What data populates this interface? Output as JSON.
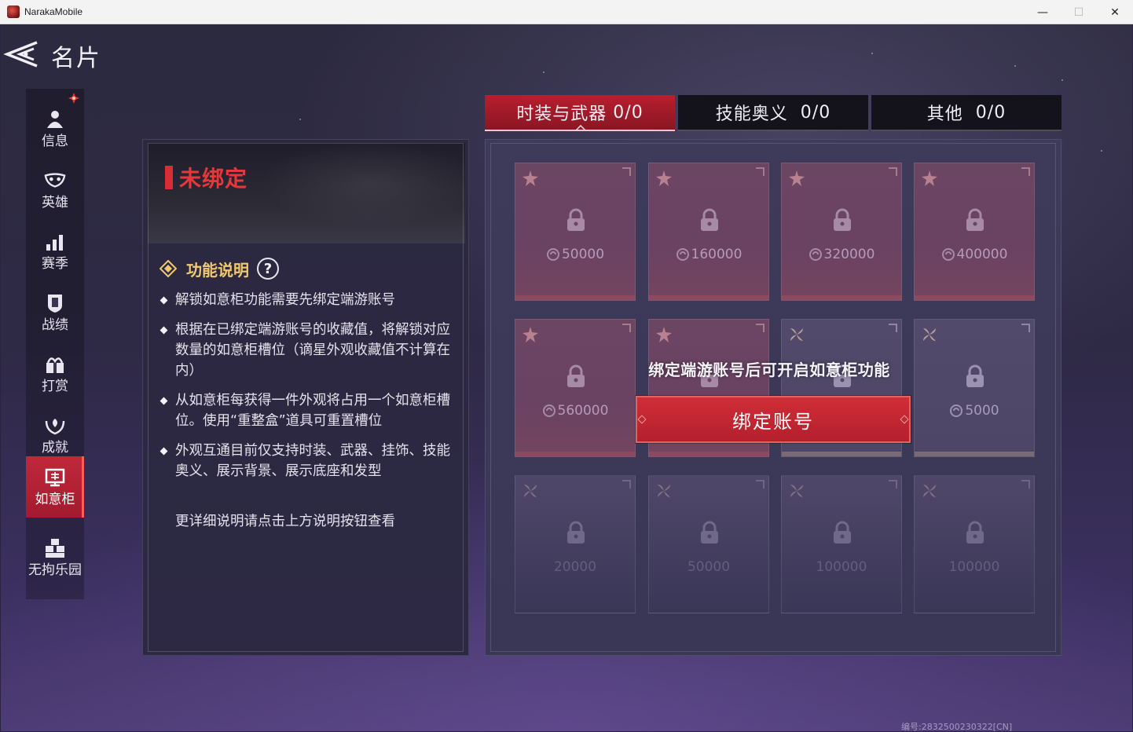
{
  "window": {
    "title": "NarakaMobile",
    "minimize_glyph": "—",
    "maximize_glyph": "☐",
    "close_glyph": "✕"
  },
  "header": {
    "title": "名片"
  },
  "sidebar": {
    "items": [
      {
        "label": "信息",
        "icon": "person-icon",
        "has_notification": true
      },
      {
        "label": "英雄",
        "icon": "mask-icon"
      },
      {
        "label": "赛季",
        "icon": "bar-chart-icon"
      },
      {
        "label": "战绩",
        "icon": "shield-icon"
      },
      {
        "label": "打赏",
        "icon": "gift-icon"
      },
      {
        "label": "成就",
        "icon": "laurel-icon"
      },
      {
        "label": "如意柜",
        "icon": "cabinet-icon",
        "active": true
      },
      {
        "label": "无拘乐园",
        "icon": "blocks-icon"
      }
    ]
  },
  "info_panel": {
    "status": "未绑定",
    "feature_title": "功能说明",
    "help_glyph": "?",
    "bullets": [
      "解锁如意柜功能需要先绑定端游账号",
      "根据在已绑定端游账号的收藏值，将解锁对应数量的如意柜槽位（谪星外观收藏值不计算在内）",
      "从如意柜每获得一件外观将占用一个如意柜槽位。使用“重整盒”道具可重置槽位",
      "外观互通目前仅支持时装、武器、挂饰、技能奥义、展示背景、展示底座和发型"
    ],
    "more_info": "更详细说明请点击上方说明按钮查看"
  },
  "tabs": [
    {
      "label": "时装与武器",
      "count": "0/0",
      "active": true
    },
    {
      "label": "技能奥义",
      "count": "0/0"
    },
    {
      "label": "其他",
      "count": "0/0"
    }
  ],
  "slots": {
    "row1": [
      "50000",
      "160000",
      "320000",
      "400000"
    ],
    "row2": [
      "560000",
      "5000"
    ],
    "row3": [
      "20000",
      "50000",
      "100000",
      "100000"
    ]
  },
  "bind": {
    "hint": "绑定端游账号后可开启如意柜功能",
    "button": "绑定账号"
  },
  "footer": {
    "serial": "编号:2832500230322[CN]"
  },
  "colors": {
    "accent_red": "#c1283b",
    "gold": "#f0c96e",
    "status_red": "#e4383b"
  }
}
